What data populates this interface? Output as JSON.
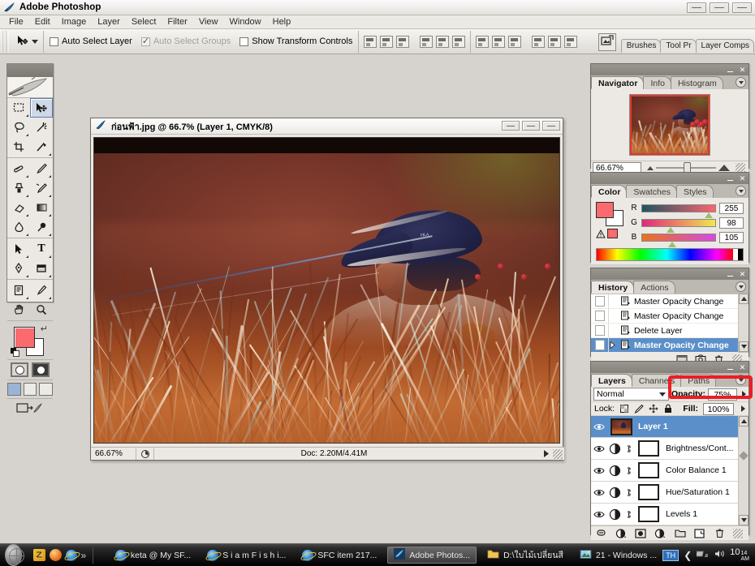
{
  "app": {
    "title": "Adobe Photoshop",
    "logo_icon": "photoshop-feather-icon"
  },
  "window_controls": {
    "minimize": "minimize-icon",
    "maximize": "maximize-icon",
    "close": "close-icon"
  },
  "menubar": {
    "items": [
      "File",
      "Edit",
      "Image",
      "Layer",
      "Select",
      "Filter",
      "View",
      "Window",
      "Help"
    ]
  },
  "options_bar": {
    "tool_icon": "move-tool-icon",
    "preset_caret": "chevron-down-icon",
    "auto_select_layer": {
      "label": "Auto Select Layer",
      "checked": false
    },
    "auto_select_groups": {
      "label": "Auto Select Groups",
      "checked": true,
      "disabled": true
    },
    "show_transform_controls": {
      "label": "Show Transform Controls",
      "checked": false
    },
    "align_icons": [
      "align-top-edges-icon",
      "align-vertical-centers-icon",
      "align-bottom-edges-icon",
      "align-left-edges-icon",
      "align-horizontal-centers-icon",
      "align-right-edges-icon"
    ],
    "distribute_icons": [
      "distribute-top-edges-icon",
      "distribute-vertical-centers-icon",
      "distribute-bottom-edges-icon",
      "distribute-left-edges-icon",
      "distribute-horizontal-centers-icon",
      "distribute-right-edges-icon"
    ],
    "palette_well": {
      "toggle_icon": "image-ready-jump-icon",
      "tabs": [
        "Brushes",
        "Tool Pr",
        "Layer Comps"
      ]
    }
  },
  "toolbox": {
    "tools": [
      {
        "name": "rectangular-marquee-tool",
        "selected": false
      },
      {
        "name": "move-tool",
        "selected": true
      },
      {
        "name": "lasso-tool",
        "selected": false
      },
      {
        "name": "magic-wand-tool",
        "selected": false
      },
      {
        "name": "crop-tool",
        "selected": false
      },
      {
        "name": "slice-tool",
        "selected": false
      },
      {
        "name": "healing-brush-tool",
        "selected": false
      },
      {
        "name": "brush-tool",
        "selected": false
      },
      {
        "name": "clone-stamp-tool",
        "selected": false
      },
      {
        "name": "history-brush-tool",
        "selected": false
      },
      {
        "name": "eraser-tool",
        "selected": false
      },
      {
        "name": "gradient-tool",
        "selected": false
      },
      {
        "name": "blur-tool",
        "selected": false
      },
      {
        "name": "dodge-tool",
        "selected": false
      },
      {
        "name": "path-selection-tool",
        "selected": false
      },
      {
        "name": "type-tool",
        "selected": false
      },
      {
        "name": "pen-tool",
        "selected": false
      },
      {
        "name": "rectangle-shape-tool",
        "selected": false
      },
      {
        "name": "notes-tool",
        "selected": false
      },
      {
        "name": "eyedropper-tool",
        "selected": false
      },
      {
        "name": "hand-tool",
        "selected": false
      },
      {
        "name": "zoom-tool",
        "selected": false
      }
    ],
    "foreground_color": "#fa6a6e",
    "background_color": "#ffffff",
    "type_tool_glyph": "T",
    "screen_modes": [
      "standard-screen-mode",
      "full-screen-with-menubar",
      "full-screen-mode"
    ],
    "jump_to_label": "jump-to-imageready-icon"
  },
  "document": {
    "icon": "document-icon",
    "title": "ก่อนฟ้า.jpg @ 66.7% (Layer 1, CMYK/8)",
    "status": {
      "zoom": "66.67%",
      "preview_icon": "doc-preview-icon",
      "doc_size": "Doc: 2.20M/4.41M",
      "arrow_icon": "play-arrow-icon"
    },
    "window_buttons": [
      "minimize",
      "maximize",
      "close"
    ],
    "photo_description": "Fisherman in navy FILA cap and white shirt among orange reeds"
  },
  "navigator_palette": {
    "tabs": [
      {
        "label": "Navigator",
        "active": true
      },
      {
        "label": "Info",
        "active": false
      },
      {
        "label": "Histogram",
        "active": false
      }
    ],
    "menu_icon": "palette-menu-icon",
    "zoom_value": "66.67%",
    "zoom_out_icon": "small-mountain-icon",
    "zoom_in_icon": "large-mountain-icon",
    "resize_icon": "resize-grip-icon",
    "view_box_color": "#e0392c"
  },
  "color_palette": {
    "tabs": [
      {
        "label": "Color",
        "active": true
      },
      {
        "label": "Swatches",
        "active": false
      },
      {
        "label": "Styles",
        "active": false
      }
    ],
    "menu_icon": "palette-menu-icon",
    "warning_icon": "out-of-gamut-warning-icon",
    "channels": [
      {
        "label": "R",
        "value": "255",
        "thumb_pct": 88
      },
      {
        "label": "G",
        "value": "98",
        "thumb_pct": 36
      },
      {
        "label": "B",
        "value": "105",
        "thumb_pct": 38
      }
    ],
    "foreground_color": "#fa6a6e",
    "background_color": "#ffffff"
  },
  "history_palette": {
    "tabs": [
      {
        "label": "History",
        "active": true
      },
      {
        "label": "Actions",
        "active": false
      }
    ],
    "menu_icon": "palette-menu-icon",
    "items": [
      {
        "label": "Master Opacity Change",
        "selected": false,
        "has_caret": false
      },
      {
        "label": "Master Opacity Change",
        "selected": false,
        "has_caret": false
      },
      {
        "label": "Delete Layer",
        "selected": false,
        "has_caret": false
      },
      {
        "label": "Master Opacity Change",
        "selected": true,
        "has_caret": true
      }
    ],
    "footer_icons": [
      "new-document-from-state-icon",
      "new-snapshot-icon",
      "delete-state-icon"
    ],
    "scroll_up_icon": "scroll-up-arrow",
    "scroll_down_icon": "scroll-down-arrow"
  },
  "layers_palette": {
    "tabs": [
      {
        "label": "Layers",
        "active": true
      },
      {
        "label": "Channels",
        "active": false
      },
      {
        "label": "Paths",
        "active": false
      }
    ],
    "menu_icon": "palette-menu-icon",
    "blend_mode": "Normal",
    "opacity_label": "Opacity:",
    "opacity_value": "75%",
    "lock_label": "Lock:",
    "lock_icons": [
      "lock-transparent-pixels-icon",
      "lock-image-pixels-icon",
      "lock-position-icon",
      "lock-all-icon"
    ],
    "fill_label": "Fill:",
    "fill_value": "100%",
    "layers": [
      {
        "name": "Layer 1",
        "selected": true,
        "type": "image",
        "visible": true,
        "linked": false
      },
      {
        "name": "Brightness/Cont...",
        "selected": false,
        "type": "adjustment",
        "visible": true,
        "linked": true
      },
      {
        "name": "Color Balance 1",
        "selected": false,
        "type": "adjustment",
        "visible": true,
        "linked": true
      },
      {
        "name": "Hue/Saturation 1",
        "selected": false,
        "type": "adjustment",
        "visible": true,
        "linked": true
      },
      {
        "name": "Levels 1",
        "selected": false,
        "type": "adjustment",
        "visible": true,
        "linked": true
      }
    ],
    "footer_icons": [
      "link-layers-icon",
      "layer-style-icon",
      "layer-mask-icon",
      "new-adjustment-layer-icon",
      "new-group-icon",
      "new-layer-icon",
      "delete-layer-icon"
    ],
    "annotation_color": "#ee1c24",
    "annotation_target": "opacity-field"
  },
  "taskbar": {
    "start_label": "start-orb",
    "quick_launch": [
      "quicklaunch-icon-1",
      "quicklaunch-icon-2",
      "internet-explorer-icon"
    ],
    "quick_launch_more": "»",
    "tasks": [
      {
        "label": "keta @ My SF...",
        "icon": "internet-explorer-icon",
        "active": false
      },
      {
        "label": "S i a m F i s h i...",
        "icon": "internet-explorer-icon",
        "active": false
      },
      {
        "label": "SFC item 217...",
        "icon": "internet-explorer-icon",
        "active": false
      },
      {
        "label": "Adobe Photos...",
        "icon": "photoshop-icon",
        "active": true
      },
      {
        "label": "D:\\ใบไม้เปลี่ยนสี",
        "icon": "folder-icon",
        "active": false
      },
      {
        "label": "21 - Windows ...",
        "icon": "windows-picture-viewer-icon",
        "active": false
      }
    ],
    "tray": {
      "language": "TH",
      "icons": [
        "show-desktop-arrow-icon",
        "network-icon",
        "volume-icon"
      ],
      "clock_hour": "10",
      "clock_minute": "14",
      "clock_ampm": "AM"
    }
  }
}
